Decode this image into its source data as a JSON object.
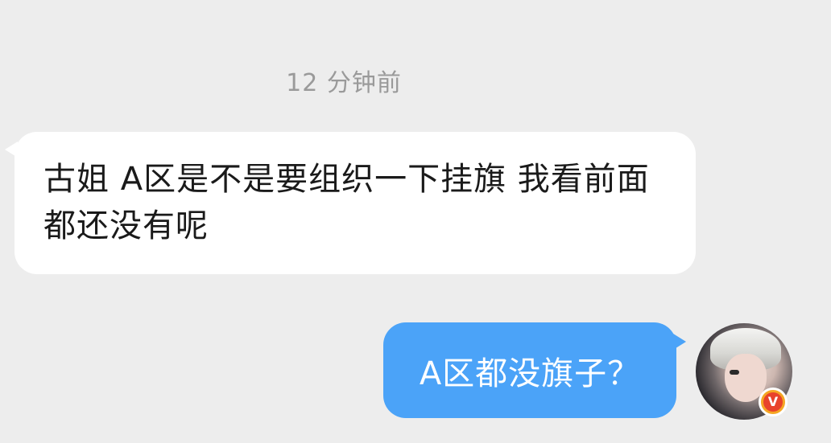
{
  "chat": {
    "timestamp": "12 分钟前",
    "messages": [
      {
        "direction": "incoming",
        "text": "古姐 A区是不是要组织一下挂旗 我看前面都还没有呢"
      },
      {
        "direction": "outgoing",
        "text": "A区都没旗子？"
      }
    ]
  },
  "avatar": {
    "badge_label": "V",
    "badge_color": "#f5a623"
  },
  "colors": {
    "background": "#ededed",
    "incoming_bubble": "#ffffff",
    "outgoing_bubble": "#4ba3f8"
  },
  "icons": [
    "verified-badge-icon"
  ]
}
